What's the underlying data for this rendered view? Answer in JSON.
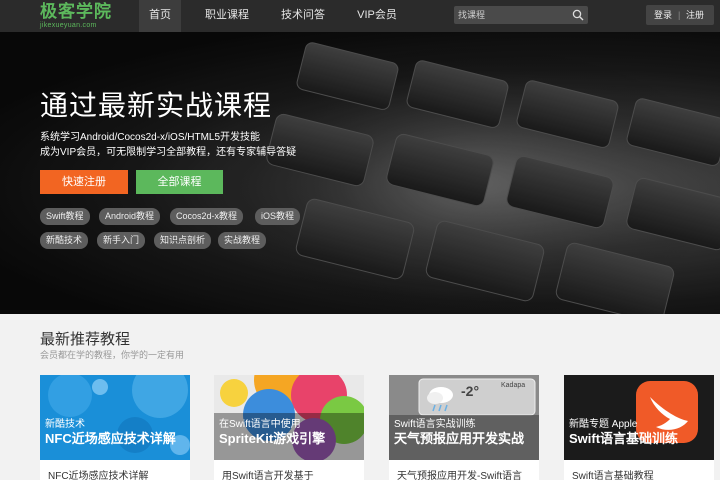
{
  "logo": {
    "main": "极客学院",
    "sub": "jikexueyuan.com"
  },
  "nav": {
    "items": [
      {
        "label": "首页"
      },
      {
        "label": "职业课程"
      },
      {
        "label": "技术问答"
      },
      {
        "label": "VIP会员"
      }
    ],
    "search_placeholder": "找课程",
    "login": "登录",
    "separator": "|",
    "register": "注册"
  },
  "hero": {
    "title": "通过最新实战课程",
    "line1": "系统学习Android/Cocos2d-x/iOS/HTML5开发技能",
    "line2": "成为VIP会员，可无限制学习全部教程，还有专家辅导答疑",
    "btn_register": "快速注册",
    "btn_courses": "全部课程",
    "tags": [
      "Swift教程",
      "Android教程",
      "Cocos2d-x教程",
      "iOS教程",
      "新酷技术",
      "新手入门",
      "知识点剖析",
      "实战教程"
    ]
  },
  "recommend": {
    "title": "最新推荐教程",
    "subtitle": "会员都在学的教程，你学的一定有用",
    "cards": [
      {
        "kicker": "新酷技术",
        "headline": "NFC近场感应技术详解",
        "caption": "NFC近场感应技术详解"
      },
      {
        "kicker": "在Swift语言中使用",
        "headline": "SpriteKit游戏引擎",
        "caption": "用Swift语言开发基于"
      },
      {
        "kicker": "Swift语言实战训练",
        "headline": "天气预报应用开发实战",
        "caption": "天气预报应用开发-Swift语言"
      },
      {
        "kicker": "新酷专题 Apple",
        "headline": "Swift语言基础训练",
        "caption": "Swift语言基础教程"
      }
    ],
    "weather_widget": {
      "temp": "-2°",
      "city": "Kadapa"
    }
  },
  "colors": {
    "brand_green": "#5cb85c",
    "orange": "#f26522",
    "nav_bg": "#2b2b2b"
  }
}
